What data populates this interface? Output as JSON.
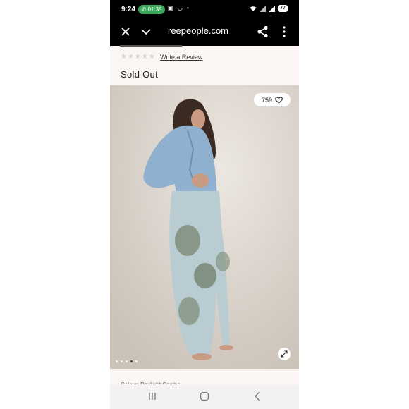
{
  "status_bar": {
    "time": "9:24",
    "call_duration": "01:35",
    "notification_icons": [
      "screenshot-icon",
      "voicemail-icon"
    ],
    "notification_dot": "•",
    "battery": "77"
  },
  "browser_toolbar": {
    "url": "reepeople.com",
    "icons": [
      "close-icon",
      "chevron-down-icon",
      "share-icon",
      "more-vertical-icon"
    ]
  },
  "product": {
    "rating_stars": "★★★★★",
    "write_review": "Write a Review",
    "availability": "Sold Out",
    "favorite_count": "759",
    "gallery_slide_active": 4,
    "gallery_slides": 5,
    "colour_label": "Colour: Daylight Combo"
  },
  "nav_bar": {
    "icons": [
      "recent-apps-icon",
      "home-icon",
      "back-icon"
    ]
  },
  "colors": {
    "status_bar_bg": "#000000",
    "call_pill": "#3aa85a",
    "page_bg": "#fbf6f3"
  }
}
